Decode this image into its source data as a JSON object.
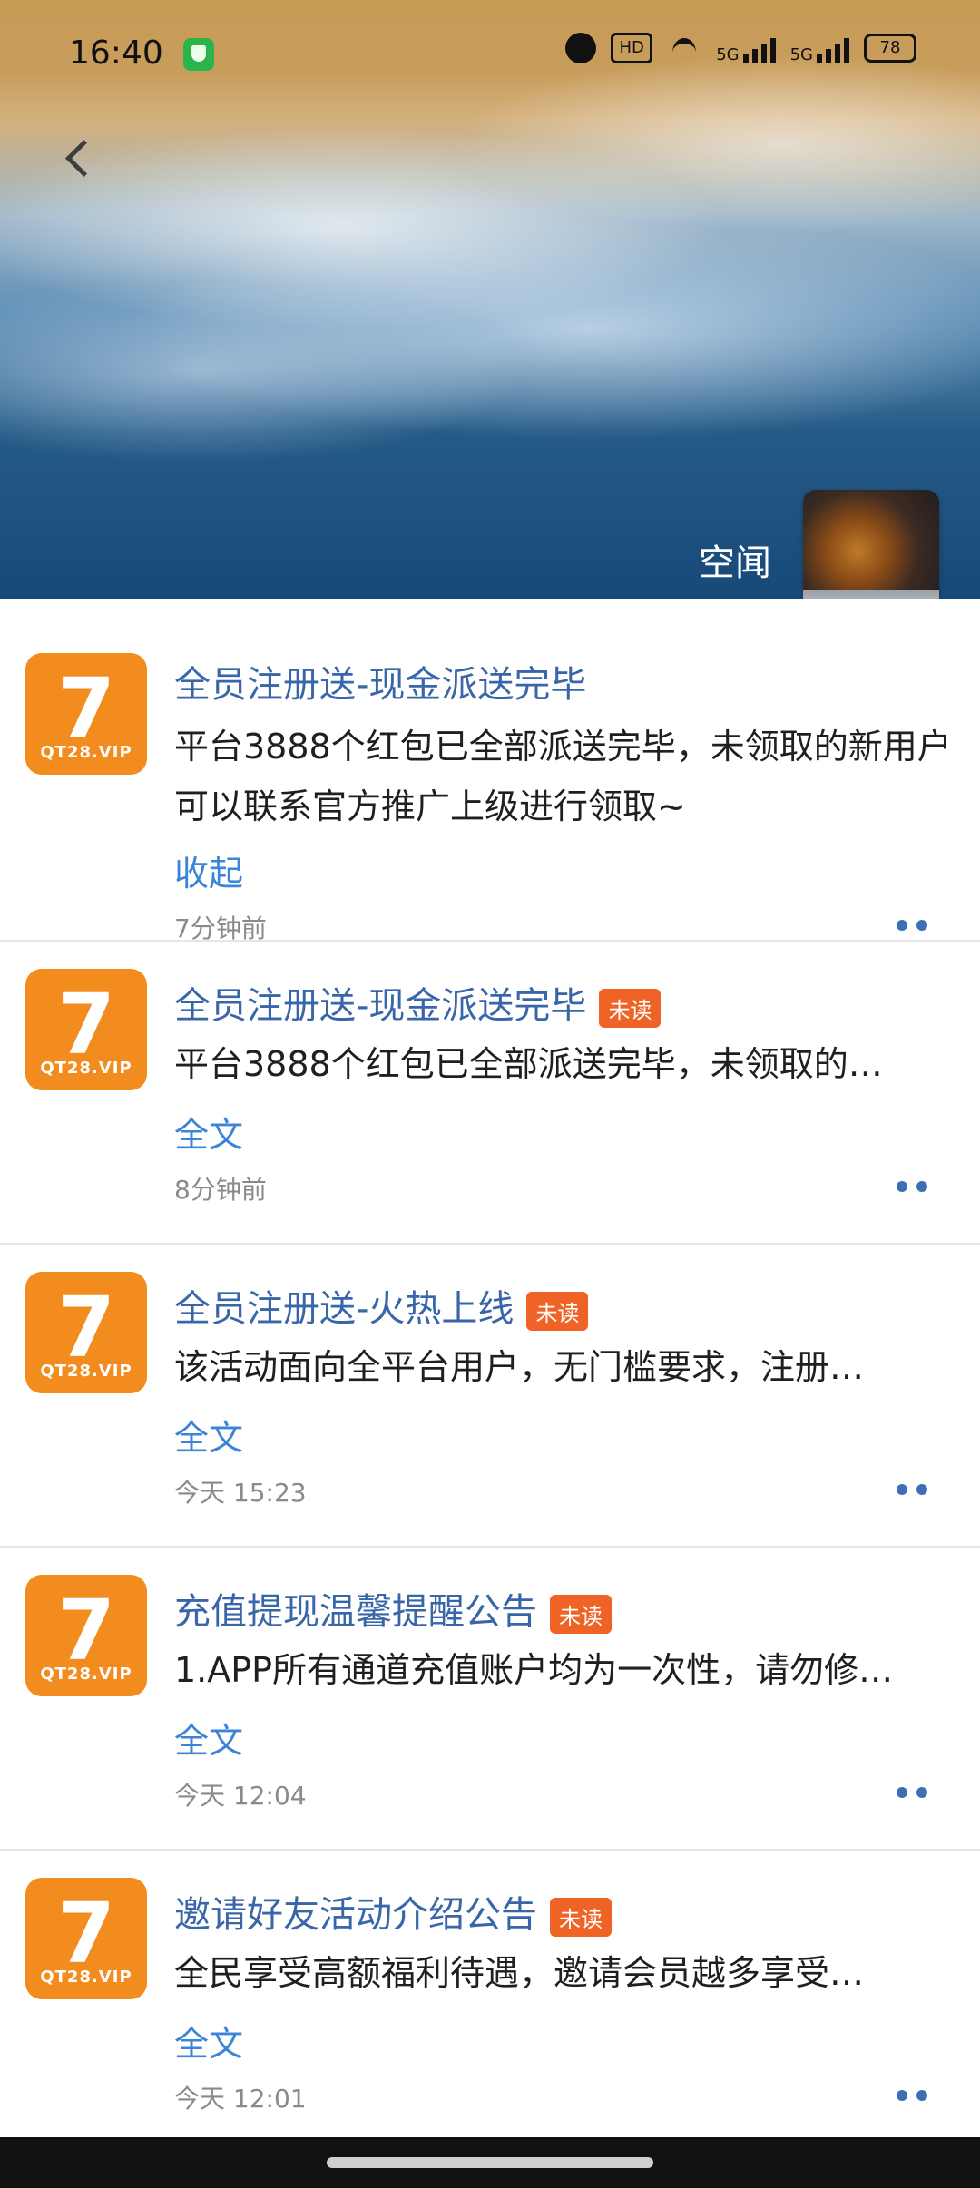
{
  "status_bar": {
    "time": "16:40",
    "battery": "78",
    "network_1": "5G",
    "network_2": "5G",
    "icons": [
      "shield-app-icon",
      "alarm-icon",
      "hd-icon",
      "wifi-icon",
      "signal-icon",
      "signal-icon",
      "battery-icon"
    ]
  },
  "header": {
    "profile_name": "空闻"
  },
  "logo": {
    "digit": "7",
    "text": "QT28.VIP"
  },
  "list": [
    {
      "title": "全员注册送-现金派送完毕",
      "unread_badge": "",
      "body": "平台3888个红包已全部派送完毕，未领取的新用户可以联系官方推广上级进行领取~",
      "action": "收起",
      "time": "7分钟前"
    },
    {
      "title": "全员注册送-现金派送完毕",
      "unread_badge": "未读",
      "body": "平台3888个红包已全部派送完毕，未领取的…",
      "action": "全文",
      "time": "8分钟前"
    },
    {
      "title": "全员注册送-火热上线",
      "unread_badge": "未读",
      "body": "该活动面向全平台用户，无门槛要求，注册…",
      "action": "全文",
      "time": "今天 15:23"
    },
    {
      "title": "充值提现温馨提醒公告",
      "unread_badge": "未读",
      "body": "1.APP所有通道充值账户均为一次性，请勿修…",
      "action": "全文",
      "time": "今天 12:04"
    },
    {
      "title": "邀请好友活动介绍公告",
      "unread_badge": "未读",
      "body": "全民享受高额福利待遇，邀请会员越多享受…",
      "action": "全文",
      "time": "今天 12:01"
    }
  ]
}
